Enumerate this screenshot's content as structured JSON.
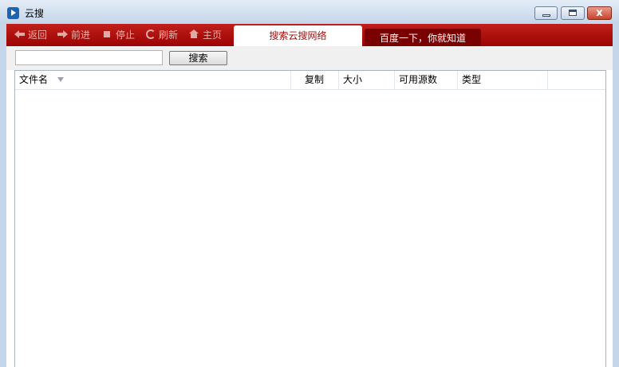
{
  "window": {
    "title": "云搜",
    "minimize_icon": "minimize-icon",
    "maximize_icon": "maximize-icon",
    "close_icon": "close-icon",
    "close_glyph": "x"
  },
  "toolbar": {
    "back": "返回",
    "forward": "前进",
    "stop": "停止",
    "refresh": "刷新",
    "home": "主页"
  },
  "tabs": [
    {
      "label": "搜索云搜网络",
      "active": true
    },
    {
      "label": "百度一下，你就知道",
      "active": false
    }
  ],
  "search": {
    "value": "",
    "placeholder": "",
    "button": "搜索"
  },
  "table": {
    "columns": [
      "文件名",
      "复制",
      "大小",
      "可用源数",
      "类型"
    ],
    "sorted_column": "文件名",
    "rows": []
  },
  "colors": {
    "brand": "#a40404",
    "tab_text": "#9b0c0c"
  }
}
